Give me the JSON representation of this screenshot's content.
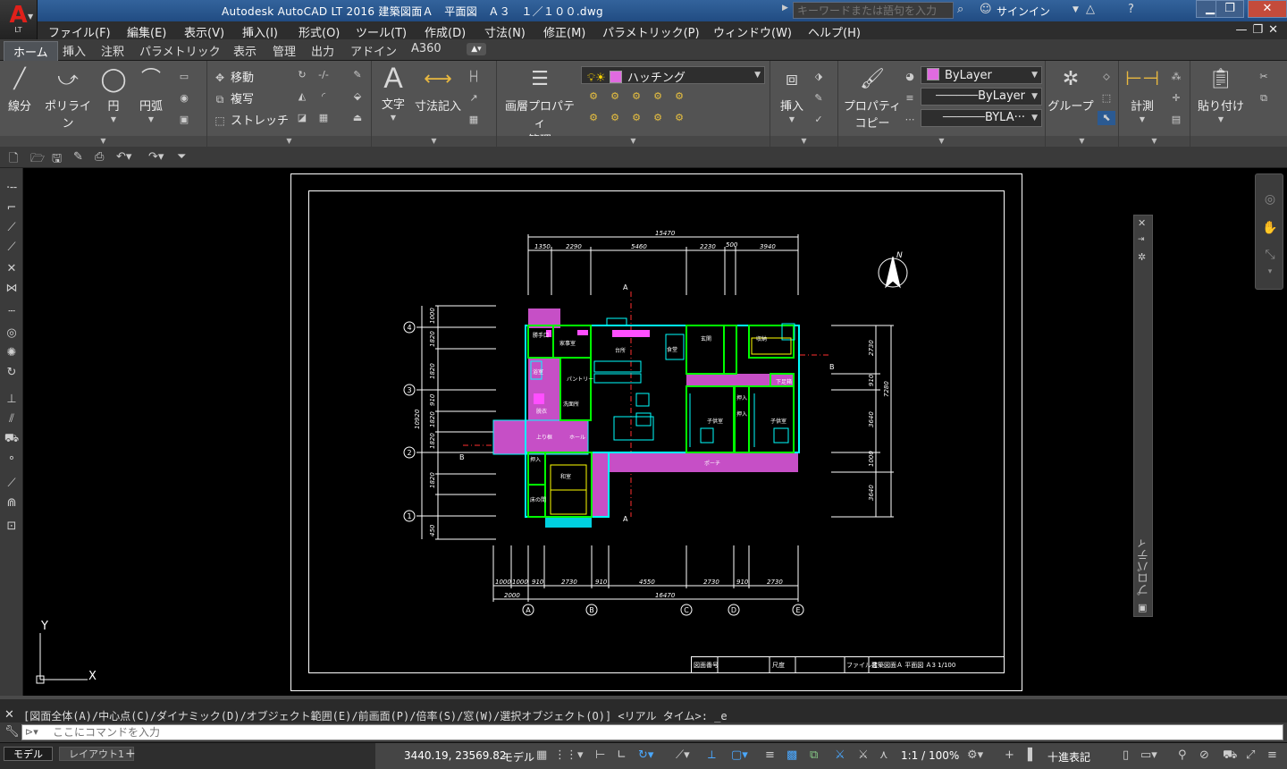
{
  "title_bar": {
    "logo_letter": "A",
    "logo_sub": "LT",
    "title": "Autodesk AutoCAD LT 2016    建築図面Ａ　平面図　Ａ３　１／１００.dwg",
    "search_placeholder": "キーワードまたは語句を入力",
    "signin_label": "サインイン"
  },
  "menu": {
    "items": [
      "ファイル(F)",
      "編集(E)",
      "表示(V)",
      "挿入(I)",
      "形式(O)",
      "ツール(T)",
      "作成(D)",
      "寸法(N)",
      "修正(M)",
      "パラメトリック(P)",
      "ウィンドウ(W)",
      "ヘルプ(H)"
    ]
  },
  "ribbon_tabs": [
    "ホーム",
    "挿入",
    "注釈",
    "パラメトリック",
    "表示",
    "管理",
    "出力",
    "アドイン",
    "A360"
  ],
  "ribbon": {
    "draw": [
      "線分",
      "ポリライン",
      "円",
      "円弧"
    ],
    "modify": [
      "移動",
      "複写",
      "ストレッチ"
    ],
    "annotation": [
      "文字",
      "寸法記入"
    ],
    "layer_props_line1": "画層プロパティ",
    "layer_props_line2": "管理",
    "layer_current": "ハッチング",
    "insert_label": "挿入",
    "props_copy_line1": "プロパティ",
    "props_copy_line2": "コピー",
    "color_value": "ByLayer",
    "linetype_value": "ByLayer",
    "lineweight_value": "BYLA···",
    "group_label": "グループ",
    "measure_label": "計測",
    "paste_label": "貼り付け"
  },
  "drawing": {
    "title_block_cells": [
      "図面番号",
      "尺度",
      "ファイル名",
      "建築図面Ａ 平面図 Ａ3 1/100"
    ],
    "top_overall_dim": "15470",
    "top_dims": [
      "1350",
      "2290",
      "5460",
      "2230",
      "500",
      "3940"
    ],
    "bottom_overall_dim": "16470",
    "bottom_dims": [
      "1000",
      "1000",
      "910",
      "2730",
      "910",
      "4550",
      "2730",
      "910",
      "2730"
    ],
    "bottom_sub_dim": "2000",
    "left_overall_dim": "10920",
    "left_dims": [
      "1000",
      "1820",
      "1820",
      "910",
      "1820",
      "1820",
      "1820",
      "450"
    ],
    "right_dims": [
      "2730",
      "910",
      "3640",
      "1000",
      "3640"
    ],
    "right_overall_dim": "7280",
    "column_grid": [
      "A",
      "B",
      "C",
      "D",
      "E"
    ],
    "row_grid": [
      "1",
      "2",
      "3",
      "4"
    ],
    "section_a": "A",
    "section_b": "B",
    "north_mark": "N",
    "rooms": [
      "勝手口",
      "家事室",
      "台所",
      "食堂",
      "玄関",
      "下足箱",
      "浴室",
      "洗面所",
      "脱衣",
      "ホール",
      "和室",
      "押入",
      "子供室",
      "押入",
      "押入",
      "子供室",
      "床の間",
      "収納",
      "ポーチ",
      "パントリー",
      "上り框"
    ],
    "ucs_y": "Y",
    "ucs_x": "X"
  },
  "command": {
    "history": "[図面全体(A)/中心点(C)/ダイナミック(D)/オブジェクト範囲(E)/前画面(P)/倍率(S)/窓(W)/選択オブジェクト(O)] <リアル タイム>: _e",
    "input_placeholder": "ここにコマンドを入力"
  },
  "layout_tabs": [
    "モデル",
    "レイアウト1"
  ],
  "status": {
    "coordinates": "3440.19, 23569.82",
    "space": "モデル",
    "scale": "1:1 / 100%",
    "units": "十進表記"
  },
  "side_palette_label": "プロパティ",
  "colors": {
    "cad_cyan": "#00ffff",
    "cad_green": "#00ff00",
    "cad_magenta": "#ff00ff",
    "cad_yellow": "#ffff00",
    "cad_red": "#ff3030",
    "ribbon_bg": "#535353",
    "titlebar_bg": "#2b5a92"
  }
}
